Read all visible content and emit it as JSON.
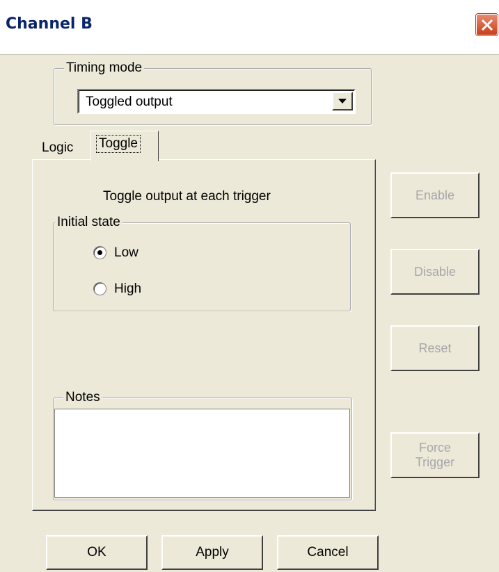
{
  "window": {
    "title": "Channel B",
    "close_icon": "close-icon"
  },
  "timing_mode": {
    "legend": "Timing mode",
    "selected": "Toggled output",
    "arrow_icon": "chevron-down-icon"
  },
  "tabs": [
    {
      "label": "Logic",
      "active": false
    },
    {
      "label": "Toggle",
      "active": true
    }
  ],
  "toggle_panel": {
    "heading": "Toggle output at each trigger",
    "initial_state": {
      "legend": "Initial state",
      "options": [
        {
          "label": "Low",
          "checked": true
        },
        {
          "label": "High",
          "checked": false
        }
      ]
    },
    "notes": {
      "legend": "Notes",
      "value": ""
    }
  },
  "side_buttons": {
    "enable": "Enable",
    "disable": "Disable",
    "reset": "Reset",
    "force_line1": "Force",
    "force_line2": "Trigger",
    "disabled_color": "#a7a6aa"
  },
  "footer": {
    "ok": "OK",
    "apply": "Apply",
    "cancel": "Cancel"
  }
}
